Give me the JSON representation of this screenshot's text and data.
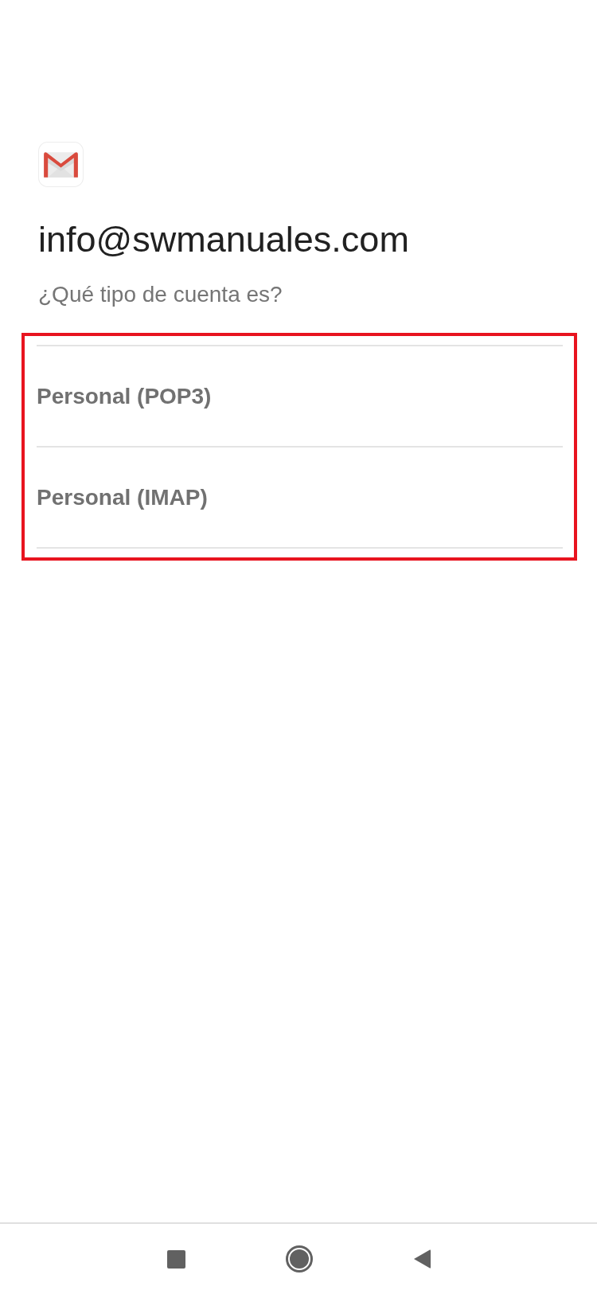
{
  "header": {
    "email": "info@swmanuales.com",
    "subtitle": "¿Qué tipo de cuenta es?"
  },
  "account_types": {
    "highlighted": true,
    "items": [
      {
        "label": "Personal (POP3)"
      },
      {
        "label": "Personal (IMAP)"
      }
    ]
  }
}
